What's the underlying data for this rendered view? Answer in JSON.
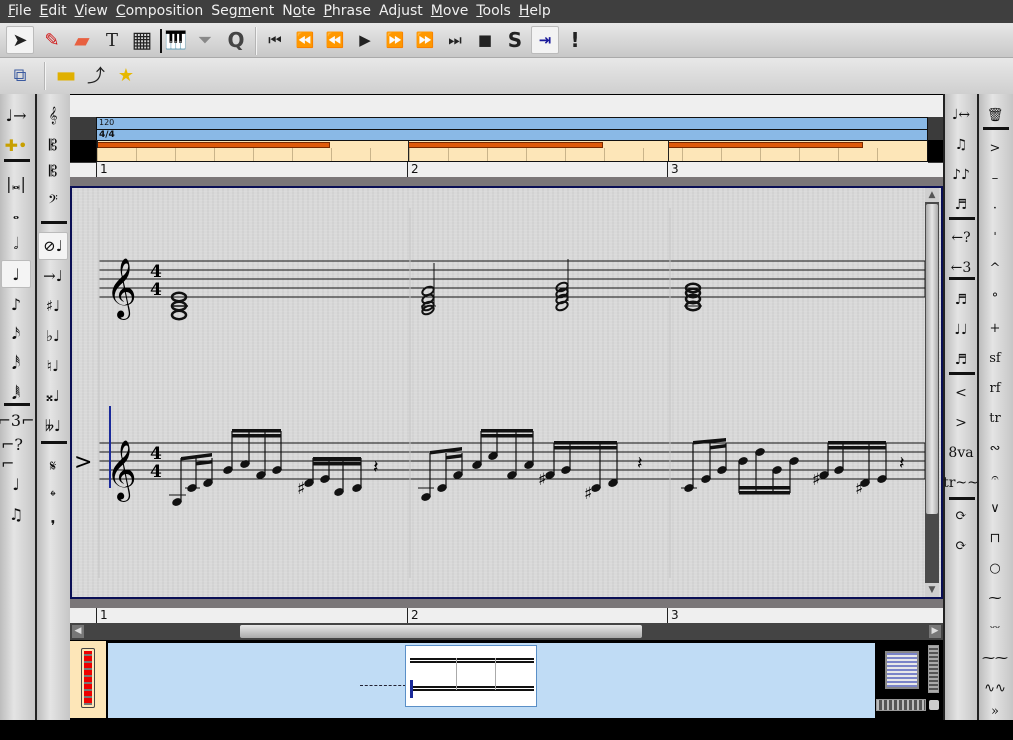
{
  "menubar": {
    "items": [
      {
        "label": "File",
        "u": "F",
        "rest": "ile"
      },
      {
        "label": "Edit",
        "u": "E",
        "rest": "dit"
      },
      {
        "label": "View",
        "u": "V",
        "rest": "iew"
      },
      {
        "label": "Composition",
        "u": "C",
        "rest": "omposition"
      },
      {
        "label": "Segment",
        "pre": "Seg",
        "u": "m",
        "rest": "ent"
      },
      {
        "label": "Note",
        "pre": "N",
        "u": "o",
        "rest": "te"
      },
      {
        "label": "Phrase",
        "u": "P",
        "rest": "hrase"
      },
      {
        "label": "Adjust",
        "pre": "Ad",
        "u": "j",
        "rest": "ust"
      },
      {
        "label": "Move",
        "u": "M",
        "rest": "ove"
      },
      {
        "label": "Tools",
        "u": "T",
        "rest": "ools"
      },
      {
        "label": "Help",
        "u": "H",
        "rest": "elp"
      }
    ]
  },
  "toolbar": {
    "tools": [
      {
        "name": "select-tool",
        "icon": "pointer-icon",
        "glyph": "➤",
        "active": true
      },
      {
        "name": "draw-tool",
        "icon": "pencil-icon",
        "glyph": "✎"
      },
      {
        "name": "erase-tool",
        "icon": "eraser-icon",
        "glyph": "▰"
      },
      {
        "name": "text-tool",
        "icon": "text-icon",
        "glyph": "T"
      },
      {
        "name": "guitar-chord-tool",
        "icon": "chord-grid-icon",
        "glyph": "▦"
      },
      {
        "name": "symbol-tool",
        "icon": "piano-hand-icon",
        "glyph": "🎹"
      },
      {
        "name": "filter-tool",
        "icon": "funnel-icon",
        "glyph": "⏷"
      },
      {
        "name": "quantize-tool",
        "icon": "quantize-icon",
        "glyph": "Q"
      }
    ],
    "transport": [
      {
        "name": "rewind-to-beginning",
        "icon": "skip-start-icon",
        "glyph": "⏮"
      },
      {
        "name": "rewind",
        "icon": "rewind-icon",
        "glyph": "⏪"
      },
      {
        "name": "fast-rewind",
        "icon": "fast-rewind-icon",
        "glyph": "⏪"
      },
      {
        "name": "play",
        "icon": "play-icon",
        "glyph": "▶"
      },
      {
        "name": "fast-forward",
        "icon": "fast-forward-icon",
        "glyph": "⏩"
      },
      {
        "name": "forward",
        "icon": "forward-icon",
        "glyph": "⏩"
      },
      {
        "name": "fast-forward-to-end",
        "icon": "skip-end-icon",
        "glyph": "⏭"
      },
      {
        "name": "stop",
        "icon": "stop-icon",
        "glyph": "■"
      },
      {
        "name": "solo",
        "icon": "solo-icon",
        "glyph": "S"
      },
      {
        "name": "scroll-to-follow",
        "icon": "follow-cursor-icon",
        "glyph": "⇥",
        "active": true
      },
      {
        "name": "panic",
        "icon": "exclamation-icon",
        "glyph": "!"
      }
    ],
    "row2": [
      {
        "name": "segment-manager",
        "icon": "segments-icon",
        "glyph": "⧉"
      },
      {
        "name": "tempo-ruler",
        "icon": "ruler-color-icon",
        "glyph": "▬"
      },
      {
        "name": "controller-ruler",
        "icon": "curve-ruler-icon",
        "glyph": "⤴"
      },
      {
        "name": "add-ruler",
        "icon": "ruler-star-icon",
        "glyph": "★"
      }
    ]
  },
  "left_palette": [
    {
      "name": "switch-to-rest",
      "icon": "note-to-rest-icon",
      "glyph": "♩→"
    },
    {
      "name": "dotted-note",
      "icon": "dot-plus-icon",
      "glyph": "✚•"
    },
    {
      "name": "breve",
      "icon": "breve-icon",
      "glyph": "|𝅜|"
    },
    {
      "name": "whole-note",
      "icon": "whole-note-icon",
      "glyph": "𝅝"
    },
    {
      "name": "half-note",
      "icon": "half-note-icon",
      "glyph": "𝅗𝅥"
    },
    {
      "name": "quarter-note",
      "icon": "quarter-note-icon",
      "glyph": "♩",
      "active": true
    },
    {
      "name": "eighth-note",
      "icon": "eighth-note-icon",
      "glyph": "♪"
    },
    {
      "name": "sixteenth-note",
      "icon": "sixteenth-note-icon",
      "glyph": "𝅘𝅥𝅯"
    },
    {
      "name": "thirty-second-note",
      "icon": "thirty-second-note-icon",
      "glyph": "𝅘𝅥𝅰"
    },
    {
      "name": "sixty-fourth-note",
      "icon": "sixty-fourth-note-icon",
      "glyph": "𝅘𝅥𝅱"
    },
    {
      "name": "triplet",
      "icon": "triplet-icon",
      "glyph": "⌐3⌐"
    },
    {
      "name": "tuplet",
      "icon": "tuplet-icon",
      "glyph": "⌐?⌐"
    },
    {
      "name": "chord-mode",
      "icon": "chord-icon",
      "glyph": "♩"
    },
    {
      "name": "grace-note",
      "icon": "grace-icon",
      "glyph": "♫"
    }
  ],
  "clef_palette": [
    {
      "name": "treble-clef",
      "icon": "treble-clef-icon",
      "glyph": "𝄞"
    },
    {
      "name": "alto-clef",
      "icon": "alto-clef-icon",
      "glyph": "𝄡"
    },
    {
      "name": "tenor-clef",
      "icon": "tenor-clef-icon",
      "glyph": "𝄡"
    },
    {
      "name": "bass-clef",
      "icon": "bass-clef-icon",
      "glyph": "𝄢"
    },
    {
      "name": "no-accidental",
      "icon": "no-accidental-icon",
      "glyph": "⊘♩",
      "active": true
    },
    {
      "name": "follow-accidental",
      "icon": "follow-accidental-icon",
      "glyph": "→♩"
    },
    {
      "name": "sharp",
      "icon": "sharp-icon",
      "glyph": "♯♩"
    },
    {
      "name": "flat",
      "icon": "flat-icon",
      "glyph": "♭♩"
    },
    {
      "name": "natural",
      "icon": "natural-icon",
      "glyph": "♮♩"
    },
    {
      "name": "double-sharp",
      "icon": "double-sharp-icon",
      "glyph": "𝄪♩"
    },
    {
      "name": "double-flat",
      "icon": "double-flat-icon",
      "glyph": "𝄫♩"
    },
    {
      "name": "segno",
      "icon": "segno-icon",
      "glyph": "𝄋"
    },
    {
      "name": "coda",
      "icon": "coda-icon",
      "glyph": "𝄌"
    },
    {
      "name": "breath",
      "icon": "breath-mark-icon",
      "glyph": "❜"
    }
  ],
  "right_palette": [
    {
      "name": "beam-break",
      "icon": "unbeam-icon",
      "glyph": "♩↔"
    },
    {
      "name": "beam",
      "icon": "beam-icon",
      "glyph": "♫"
    },
    {
      "name": "auto-beam",
      "icon": "auto-beam-icon",
      "glyph": "♪♪"
    },
    {
      "name": "break-groups",
      "icon": "break-group-icon",
      "glyph": "♬"
    },
    {
      "name": "tuplet-unknown",
      "icon": "tuplet-arrow-icon",
      "glyph": "←?"
    },
    {
      "name": "triplet-arrow",
      "icon": "triplet-arrow-icon",
      "glyph": "←3"
    },
    {
      "name": "slur",
      "icon": "slur-icon",
      "glyph": "♬"
    },
    {
      "name": "tie",
      "icon": "tie-icon",
      "glyph": "♩♩"
    },
    {
      "name": "phrasing-slur",
      "icon": "phrasing-icon",
      "glyph": "♬"
    },
    {
      "name": "crescendo",
      "icon": "crescendo-icon",
      "glyph": "<"
    },
    {
      "name": "decrescendo",
      "icon": "decrescendo-icon",
      "glyph": ">"
    },
    {
      "name": "octave-up",
      "icon": "ottava-icon",
      "glyph": "8va"
    },
    {
      "name": "trill-line",
      "icon": "trill-line-icon",
      "glyph": "tr~~"
    },
    {
      "name": "repeat-dots",
      "icon": "repeat-dots-icon",
      "glyph": "⟳"
    },
    {
      "name": "tremolo",
      "icon": "tremolo-icon",
      "glyph": "⟳"
    }
  ],
  "marks_palette": [
    {
      "name": "delete-marks",
      "icon": "trash-icon",
      "glyph": "🗑"
    },
    {
      "name": "accent",
      "icon": "accent-icon",
      "glyph": ">"
    },
    {
      "name": "tenuto",
      "icon": "tenuto-icon",
      "glyph": "–"
    },
    {
      "name": "staccato",
      "icon": "staccato-icon",
      "glyph": "·"
    },
    {
      "name": "staccatissimo",
      "icon": "staccatissimo-icon",
      "glyph": "ˈ"
    },
    {
      "name": "marcato",
      "icon": "marcato-icon",
      "glyph": "^"
    },
    {
      "name": "open",
      "icon": "open-icon",
      "glyph": "°"
    },
    {
      "name": "stopped",
      "icon": "stopped-icon",
      "glyph": "+"
    },
    {
      "name": "sforzando",
      "icon": "sf-icon",
      "glyph": "sf"
    },
    {
      "name": "rinforzando",
      "icon": "rf-icon",
      "glyph": "rf"
    },
    {
      "name": "trill",
      "icon": "trill-icon",
      "glyph": "tr"
    },
    {
      "name": "turn",
      "icon": "turn-icon",
      "glyph": "∾"
    },
    {
      "name": "pause",
      "icon": "fermata-icon",
      "glyph": "𝄐"
    },
    {
      "name": "up-bow",
      "icon": "up-bow-icon",
      "glyph": "∨"
    },
    {
      "name": "down-bow",
      "icon": "down-bow-icon",
      "glyph": "⊓"
    },
    {
      "name": "harmonic",
      "icon": "harmonic-icon",
      "glyph": "○"
    },
    {
      "name": "mordent",
      "icon": "mordent-icon",
      "glyph": "⁓"
    },
    {
      "name": "mordent-inverted",
      "icon": "inverted-mordent-icon",
      "glyph": "ᵕᵕ"
    },
    {
      "name": "long-mordent",
      "icon": "long-mordent-icon",
      "glyph": "⁓⁓"
    },
    {
      "name": "long-mordent-inverted",
      "icon": "long-inverted-mordent-icon",
      "glyph": "∿∿"
    },
    {
      "name": "more-marks",
      "icon": "double-chevron-down-icon",
      "glyph": "»"
    }
  ],
  "rulers": {
    "tempo": "120",
    "time_signature": "4/4",
    "bars": [
      "1",
      "2",
      "3"
    ]
  },
  "score": {
    "staves": [
      {
        "clef": "𝄞",
        "time": [
          "4",
          "4"
        ]
      },
      {
        "clef": "𝄞",
        "time": [
          "4",
          "4"
        ]
      }
    ],
    "staff_pointer": ">"
  },
  "colors": {
    "loop_bar": "#e05a0a",
    "tempo_ruler": "#8ab9e6",
    "beat_bg": "#fde6b8",
    "score_border": "#0a0f55",
    "cursor": "#1a2a9a"
  }
}
